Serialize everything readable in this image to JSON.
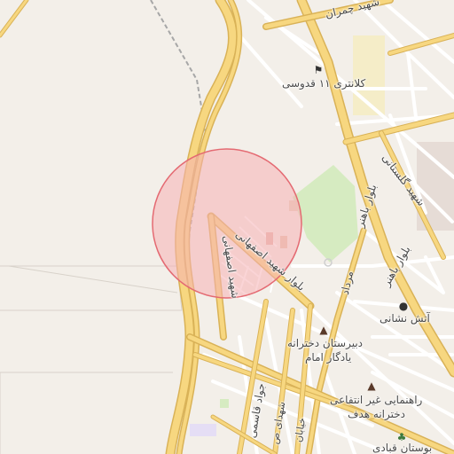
{
  "colors": {
    "background": "#f3efe9",
    "park": "#d6ebc1",
    "major_road": "#f7d780",
    "major_road_casing": "#d9b257",
    "minor_road": "#ffffff",
    "railway": "#a7a7a7",
    "search_radius_fill": "#f6b0b4",
    "search_radius_stroke": "#e46a72"
  },
  "labels": {
    "shahid_chamran": "شهید چمران",
    "kalantari": "کلانتری ۱۱ قدوسی",
    "shahid_golestani": "شهید گلستانی",
    "bolvar_bahonar": "بلوار باهنر",
    "bolvar_bahonar_2": "بلوار باهنر",
    "bolvar_shahid_esfahani": "بلوار شهید اصفهانی",
    "shahid_esfahani": "شهید اصفهانی",
    "shahid_sabahi": "شهید صیاد",
    "mordad": "مرداد",
    "atash_neshani": "آتش نشانی",
    "dabirestan_line1": "دبیرستان دخترانه",
    "dabirestan_line2": "یادگار امام",
    "rahnamaei_line1": "راهنمایی غیر انتفاعی",
    "rahnamaei_line2": "دخترانه هدف",
    "boostan": "بوستان قبادی",
    "javad_ghasemi": "جواد قاسمی",
    "shahid_line": "شهدای ص",
    "khiaban": "خیابان"
  },
  "icons": {
    "police": "police-station-icon",
    "fire": "fire-station-icon",
    "school1": "school-icon",
    "school2": "school-icon",
    "park": "park-tree-icon"
  },
  "search_circle": {
    "label": ""
  }
}
